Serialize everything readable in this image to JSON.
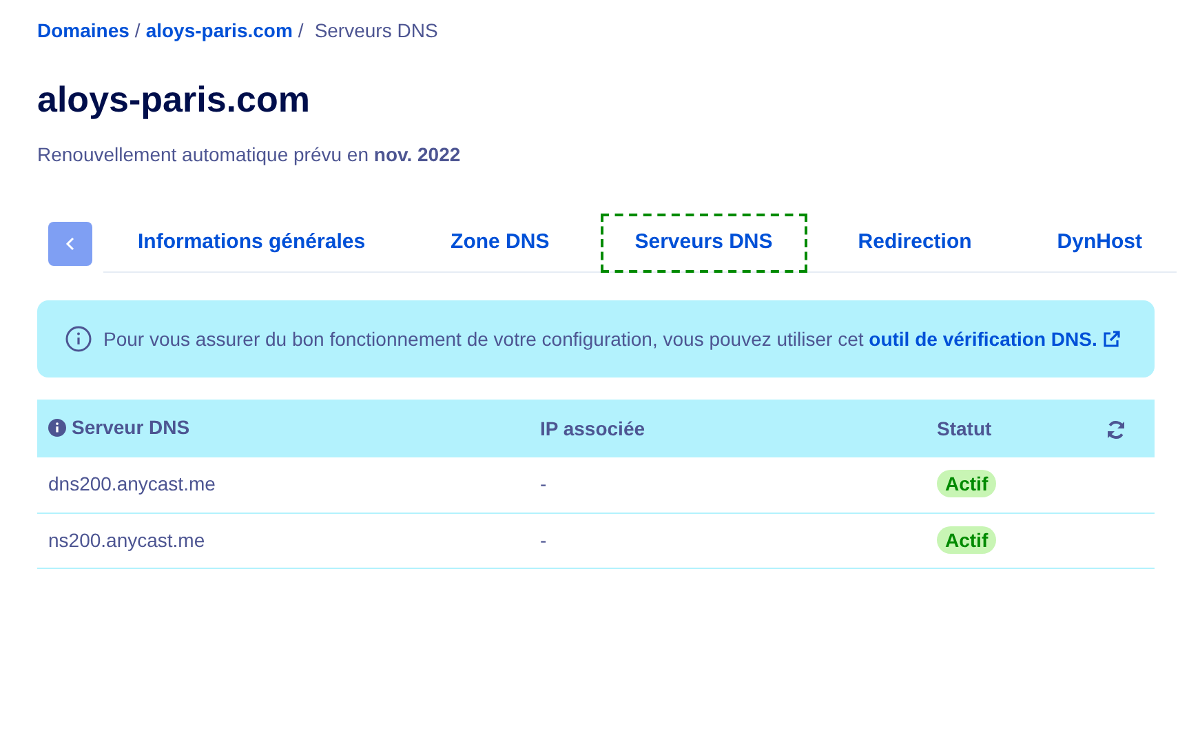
{
  "breadcrumb": [
    {
      "label": "Domaines",
      "link": true,
      "separator": "/"
    },
    {
      "label": "aloys-paris.com",
      "link": true,
      "separator": "/"
    },
    {
      "label": "Serveurs DNS",
      "link": false
    }
  ],
  "title": "aloys-paris.com",
  "subtitle": "Renouvellement automatique prévu en **nov. 2022**",
  "tabs": [
    {
      "label": "Informations générales",
      "selected": false
    },
    {
      "label": "Zone DNS",
      "selected": false
    },
    {
      "label": "Serveurs DNS",
      "selected": true
    },
    {
      "label": "Redirection",
      "selected": false
    },
    {
      "label": "DynHost",
      "selected": false
    }
  ],
  "notice": {
    "text": "Pour vous assurer du bon fonctionnement de votre configuration, vous pouvez utiliser cet",
    "link": "outil de vérification DNS."
  },
  "table": {
    "columns": [
      "Serveur DNS",
      "IP associée",
      "Statut"
    ],
    "rows": [
      {
        "server": "dns200.anycast.me",
        "ip": "-",
        "status": "Actif"
      },
      {
        "server": "ns200.anycast.me",
        "ip": "-",
        "status": "Actif"
      }
    ]
  }
}
